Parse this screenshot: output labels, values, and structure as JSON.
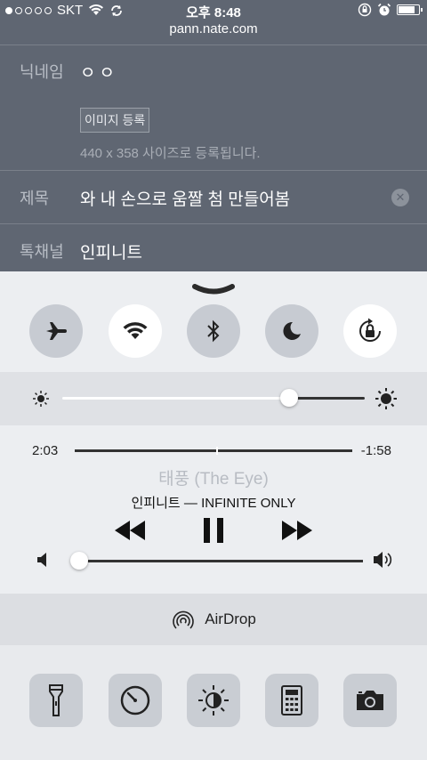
{
  "status": {
    "carrier": "SKT",
    "time": "오후 8:48",
    "battery_level": 0.85
  },
  "browser": {
    "url": "pann.nate.com"
  },
  "form": {
    "nickname_label": "닉네임",
    "nickname_value": "ㅇㅇ",
    "image_button": "이미지 등록",
    "image_note": "440 x 358 사이즈로 등록됩니다.",
    "title_label": "제목",
    "title_value": "와 내 손으로 움짤 첨 만들어봄",
    "channel_label": "톡채널",
    "channel_value": "인피니트"
  },
  "control_center": {
    "toggles": [
      {
        "name": "airplane-mode",
        "icon": "airplane-icon",
        "on": false
      },
      {
        "name": "wifi",
        "icon": "wifi-icon",
        "on": true
      },
      {
        "name": "bluetooth",
        "icon": "bluetooth-icon",
        "on": false
      },
      {
        "name": "do-not-disturb",
        "icon": "moon-icon",
        "on": false
      },
      {
        "name": "rotation-lock",
        "icon": "rotation-lock-icon",
        "on": true
      }
    ],
    "brightness_level": 0.75,
    "music": {
      "elapsed": "2:03",
      "remaining": "-1:58",
      "progress": 0.51,
      "song": "태풍 (The Eye)",
      "artist_album": "인피니트 — INFINITE ONLY",
      "volume_level": 0.02
    },
    "airdrop_label": "AirDrop",
    "tools": [
      "flashlight-icon",
      "timer-icon",
      "night-shift-icon",
      "calculator-icon",
      "camera-icon"
    ]
  },
  "colors": {
    "dim_bg": "#5f6672",
    "cc_bg": "#eceef1",
    "track_active": "#ffffff",
    "track_dark": "#333333"
  }
}
